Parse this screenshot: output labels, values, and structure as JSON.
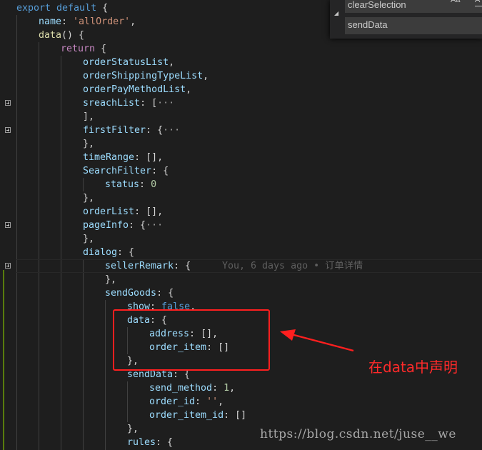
{
  "find_widget": {
    "find_value": "clearSelection",
    "replace_value": "sendData",
    "option_match_case": "Aa",
    "option_next": "A"
  },
  "code": {
    "l1": {
      "kw": "export default",
      "rest": " {"
    },
    "l2": {
      "prop": "name",
      "colon": ": ",
      "str": "'allOrder'",
      "end": ","
    },
    "l3": {
      "fn": "data",
      "rest": "() {"
    },
    "l4": {
      "ctl": "return",
      "rest": " {"
    },
    "l5": {
      "prop": "orderStatusList",
      "end": ","
    },
    "l6": {
      "prop": "orderShippingTypeList",
      "end": ","
    },
    "l7": {
      "prop": "orderPayMethodList",
      "end": ","
    },
    "l8": {
      "prop": "sreachList",
      "rest": ": [",
      "ellipsis": "···"
    },
    "l9": {
      "rest": "],"
    },
    "l10": {
      "prop": "firstFilter",
      "rest": ": {",
      "ellipsis": "···"
    },
    "l11": {
      "rest": "},"
    },
    "l12": {
      "prop": "timeRange",
      "rest": ": [],"
    },
    "l13": {
      "prop": "SearchFilter",
      "rest": ": {"
    },
    "l14": {
      "prop": "status",
      "colon": ": ",
      "num": "0"
    },
    "l15": {
      "rest": "},"
    },
    "l16": {
      "prop": "orderList",
      "rest": ": [],"
    },
    "l17": {
      "prop": "pageInfo",
      "rest": ": {",
      "ellipsis": "···"
    },
    "l18": {
      "rest": "},"
    },
    "l19": {
      "prop": "dialog",
      "rest": ": {"
    },
    "l20": {
      "prop": "sellerRemark",
      "rest": ": {"
    },
    "l21": {
      "rest": "},"
    },
    "l22": {
      "prop": "sendGoods",
      "rest": ": {"
    },
    "l23": {
      "prop": "show",
      "colon": ": ",
      "kw": "false",
      "end": ","
    },
    "l24": {
      "prop": "data",
      "rest": ": {"
    },
    "l25": {
      "prop": "address",
      "rest": ": [],"
    },
    "l26": {
      "prop": "order_item",
      "rest": ": []"
    },
    "l27": {
      "rest": "},"
    },
    "l28": {
      "prop": "sendData",
      "rest": ": {"
    },
    "l29": {
      "prop": "send_method",
      "colon": ": ",
      "num": "1",
      "end": ","
    },
    "l30": {
      "prop": "order_id",
      "colon": ": ",
      "str": "''",
      "end": ","
    },
    "l31": {
      "prop": "order_item_id",
      "rest": ": []"
    },
    "l32": {
      "rest": "},"
    },
    "l33": {
      "prop": "rules",
      "rest": ": {"
    }
  },
  "blame": {
    "author_time": "You, 6 days ago • ",
    "message": "订单详情"
  },
  "annotation_text": "在data中声明",
  "watermark": "https://blog.csdn.net/juse__we"
}
